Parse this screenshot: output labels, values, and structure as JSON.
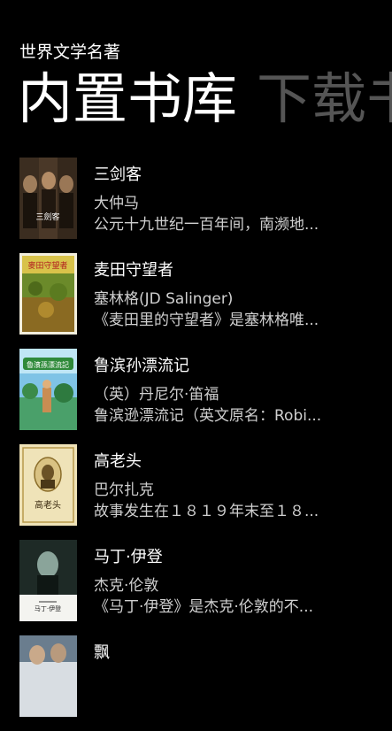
{
  "app": {
    "title": "世界文学名著"
  },
  "pivot": {
    "tabs": [
      {
        "label": "内置书库",
        "active": true
      },
      {
        "label": "下载书",
        "active": false
      }
    ]
  },
  "colors": {
    "background": "#000000",
    "active_tab": "#ffffff",
    "inactive_tab": "#555555",
    "secondary_text": "#cfcfcf"
  },
  "books": [
    {
      "title": "三剑客",
      "author": "大仲马",
      "description": "公元十九世纪一百年间，南濒地...",
      "cover_text": "三劍客"
    },
    {
      "title": "麦田守望者",
      "author": "塞林格(JD Salinger)",
      "description": "《麦田里的守望者》是塞林格唯...",
      "cover_text": "麥田守望者"
    },
    {
      "title": "鲁滨孙漂流记",
      "author": "（英）丹尼尔·笛福",
      "description": "鲁滨逊漂流记（英文原名：Robi...",
      "cover_text": "魯濱孫漂流記"
    },
    {
      "title": "高老头",
      "author": "巴尔扎克",
      "description": "故事发生在１８１９年末至１８...",
      "cover_text": "高老头"
    },
    {
      "title": "马丁·伊登",
      "author": "杰克·伦敦",
      "description": "《马丁·伊登》是杰克·伦敦的不...",
      "cover_text": "马丁·伊登"
    },
    {
      "title": "飘",
      "author": "",
      "description": "",
      "cover_text": ""
    }
  ]
}
